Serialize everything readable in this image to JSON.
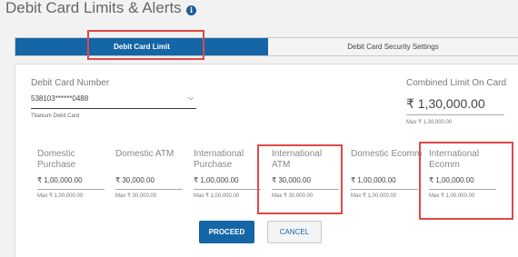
{
  "page_title": "Debit Card Limits & Alerts",
  "info_icon": "i",
  "tabs": [
    {
      "label": "Debit Card Limit"
    },
    {
      "label": "Debit Card Security Settings"
    }
  ],
  "card": {
    "label": "Debit Card Number",
    "number": "538103******0488",
    "type": "Titanium Debit Card"
  },
  "combined": {
    "label": "Combined Limit On Card",
    "amount": "₹ 1,30,000.00",
    "max": "Max ₹ 1,30,000.00"
  },
  "limits": [
    {
      "label_1": "Domestic",
      "label_2": "Purchase",
      "amount": "₹  1,00,000.00",
      "max": "Max ₹ 1,00,000.00"
    },
    {
      "label_1": "Domestic ATM",
      "label_2": "",
      "amount": "₹  30,000.00",
      "max": "Max ₹ 30,000.00"
    },
    {
      "label_1": "International",
      "label_2": "Purchase",
      "amount": "₹  1,00,000.00",
      "max": "Max ₹ 1,00,000.00"
    },
    {
      "label_1": "International",
      "label_2": "ATM",
      "amount": "₹  30,000.00",
      "max": "Max ₹ 30,000.00"
    },
    {
      "label_1": "Domestic Ecomm",
      "label_2": "",
      "amount": "₹  1,00,000.00",
      "max": "Max ₹ 1,00,000.00"
    },
    {
      "label_1": "International",
      "label_2": "Ecomm",
      "amount": "₹  1,00,000.00",
      "max": "Max ₹ 1,00,000.00"
    }
  ],
  "buttons": {
    "proceed": "PROCEED",
    "cancel": "CANCEL"
  },
  "colors": {
    "primary": "#1466a6",
    "highlight": "#e04848"
  }
}
